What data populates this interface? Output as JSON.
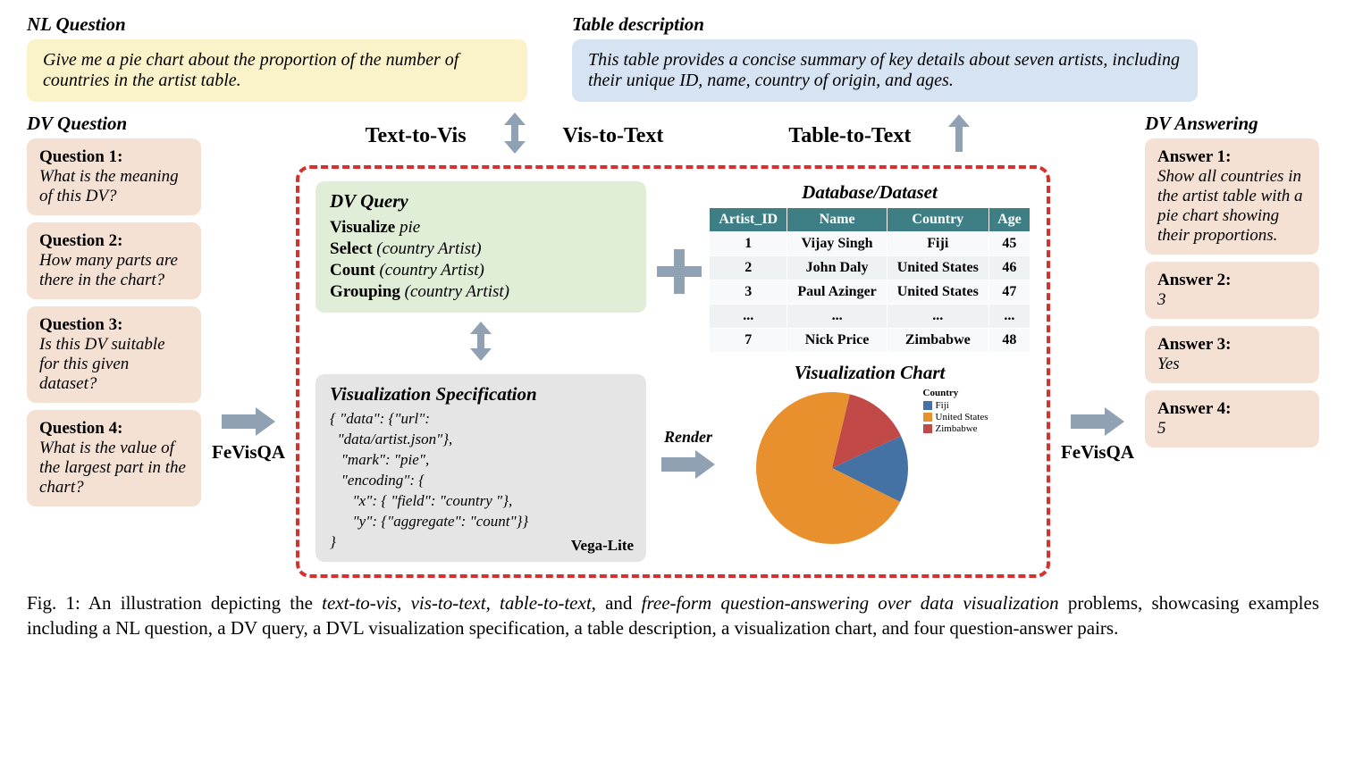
{
  "labels": {
    "nl_question": "NL Question",
    "table_description": "Table description",
    "dv_question": "DV Question",
    "dv_answering": "DV Answering",
    "dv_query": "DV Query",
    "vis_spec": "Visualization Specification",
    "db": "Database/Dataset",
    "vis_chart": "Visualization Chart",
    "vega": "Vega-Lite",
    "render": "Render",
    "fevisqa": "FeVisQA"
  },
  "nl_question_text": "Give me a pie chart about the proportion of the number of countries in the artist table.",
  "table_desc_text": "This table provides a concise summary of key details about seven artists, including their unique ID, name, country of origin, and ages.",
  "tasks": {
    "text_to_vis": "Text-to-Vis",
    "vis_to_text": "Vis-to-Text",
    "table_to_text": "Table-to-Text"
  },
  "questions": [
    {
      "title": "Question 1:",
      "text": "What is the meaning of this DV?"
    },
    {
      "title": "Question 2:",
      "text": "How many parts are there in the chart?"
    },
    {
      "title": "Question 3:",
      "text": "Is this DV suitable for this given dataset?"
    },
    {
      "title": "Question 4:",
      "text": "What is the value of the largest part  in the chart?"
    }
  ],
  "answers": [
    {
      "title": "Answer 1:",
      "text": "Show all countries in the artist table with a pie chart showing their proportions."
    },
    {
      "title": "Answer 2:",
      "text": "3"
    },
    {
      "title": "Answer 3:",
      "text": "Yes"
    },
    {
      "title": "Answer 4:",
      "text": "5"
    }
  ],
  "dv_query": [
    {
      "kw": "Visualize",
      "arg": "pie"
    },
    {
      "kw": "Select",
      "arg": "(country Artist)"
    },
    {
      "kw": "Count",
      "arg": "(country Artist)"
    },
    {
      "kw": "Grouping",
      "arg": "(country Artist)"
    }
  ],
  "vis_spec_code": "{ \"data\": {\"url\":\n  \"data/artist.json\"},\n   \"mark\": \"pie\",\n   \"encoding\": {\n      \"x\": { \"field\": \"country \"},\n      \"y\": {\"aggregate\": \"count\"}}\n}",
  "db_headers": [
    "Artist_ID",
    "Name",
    "Country",
    "Age"
  ],
  "db_rows": [
    [
      "1",
      "Vijay Singh",
      "Fiji",
      "45"
    ],
    [
      "2",
      "John Daly",
      "United States",
      "46"
    ],
    [
      "3",
      "Paul Azinger",
      "United States",
      "47"
    ],
    [
      "...",
      "...",
      "...",
      "..."
    ],
    [
      "7",
      "Nick Price",
      "Zimbabwe",
      "48"
    ]
  ],
  "chart_data": {
    "type": "pie",
    "title": "Visualization Chart",
    "legend_title": "Country",
    "series": [
      {
        "name": "Fiji",
        "value": 1,
        "color": "#4472a4"
      },
      {
        "name": "United States",
        "value": 5,
        "color": "#e8902e"
      },
      {
        "name": "Zimbabwe",
        "value": 1,
        "color": "#c14947"
      }
    ]
  },
  "caption": "Fig. 1: An illustration depicting the text-to-vis, vis-to-text, table-to-text, and free-form question-answering over data visualization problems, showcasing examples including a NL question, a DV query, a DVL visualization specification, a table description, a visualization chart, and four question-answer pairs."
}
